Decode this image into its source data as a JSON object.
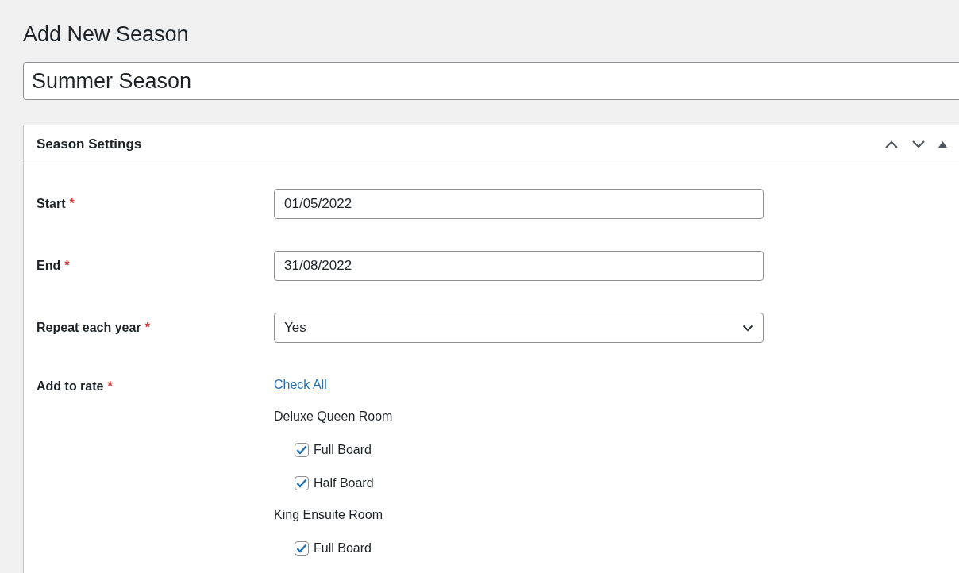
{
  "page_title": "Add New Season",
  "title_field": {
    "value": "Summer Season"
  },
  "panel": {
    "title": "Season Settings",
    "fields": [
      {
        "kind": "text",
        "label": "Start",
        "required_mark": "*",
        "value": "01/05/2022"
      },
      {
        "kind": "text",
        "label": "End",
        "required_mark": "*",
        "value": "31/08/2022"
      },
      {
        "kind": "select",
        "label": "Repeat each year",
        "required_mark": "*",
        "value": "Yes"
      },
      {
        "kind": "checklist",
        "label": "Add to rate",
        "required_mark": "*",
        "link": "Check All",
        "groups": [
          {
            "name": "Deluxe Queen Room",
            "options": [
              {
                "label": "Full Board",
                "checked": true
              },
              {
                "label": "Half Board",
                "checked": true
              }
            ]
          },
          {
            "name": "King Ensuite Room",
            "options": [
              {
                "label": "Full Board",
                "checked": true
              }
            ]
          }
        ]
      }
    ]
  }
}
